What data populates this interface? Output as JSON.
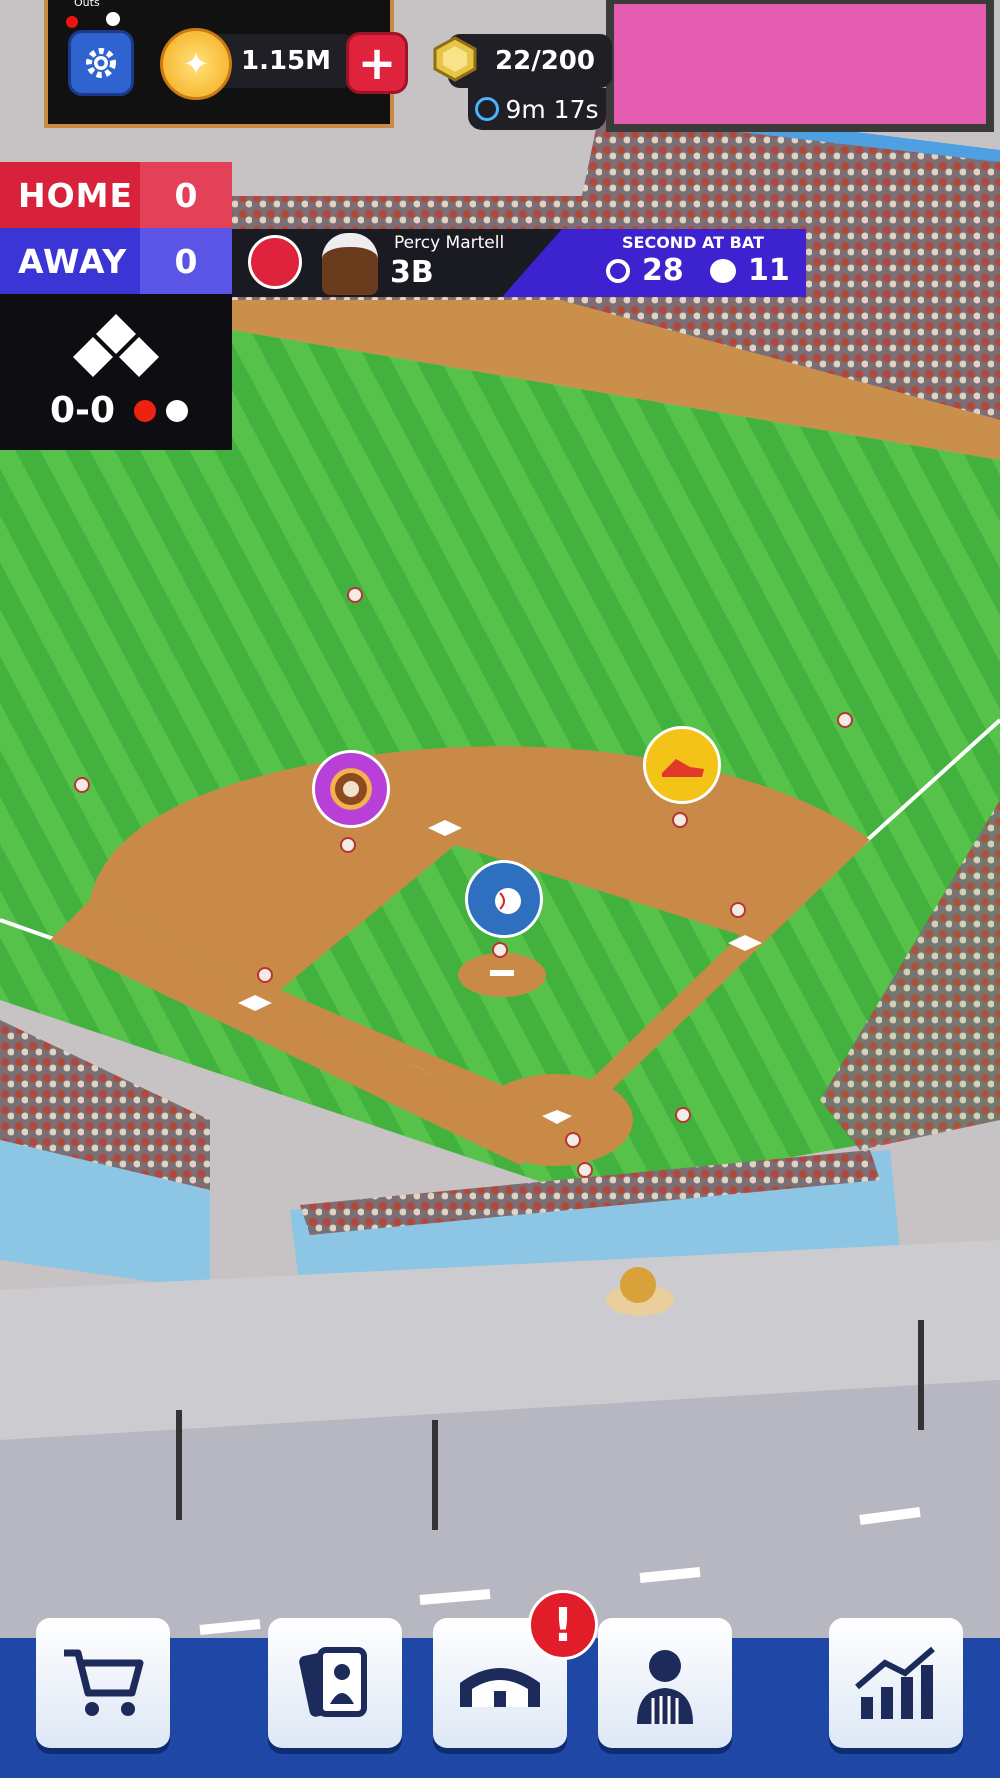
{
  "hud": {
    "outs_label": "Outs",
    "coins": "1.15M",
    "gems": "22/200",
    "timer": "9m 17s",
    "icons": {
      "settings": "gear-icon",
      "coin": "coin-icon",
      "add": "plus-icon",
      "gem": "gem-icon",
      "timer": "stopwatch-icon"
    }
  },
  "scoreboard": {
    "home_label": "HOME",
    "home_score": "0",
    "away_label": "AWAY",
    "away_score": "0",
    "count": "0-0",
    "colors": {
      "home": "#d8213a",
      "away": "#3b35d6"
    }
  },
  "at_bat": {
    "player_name": "Percy Martell",
    "position": "3B",
    "status_label": "SECOND AT BAT",
    "accuracy": "28",
    "power": "11"
  },
  "nav": {
    "items": [
      {
        "name": "shop",
        "icon": "cart-icon"
      },
      {
        "name": "cards",
        "icon": "player-cards-icon"
      },
      {
        "name": "stadium",
        "icon": "stadium-icon"
      },
      {
        "name": "staff",
        "icon": "umpire-icon"
      },
      {
        "name": "stats",
        "icon": "chart-icon"
      }
    ],
    "alert": "!"
  }
}
